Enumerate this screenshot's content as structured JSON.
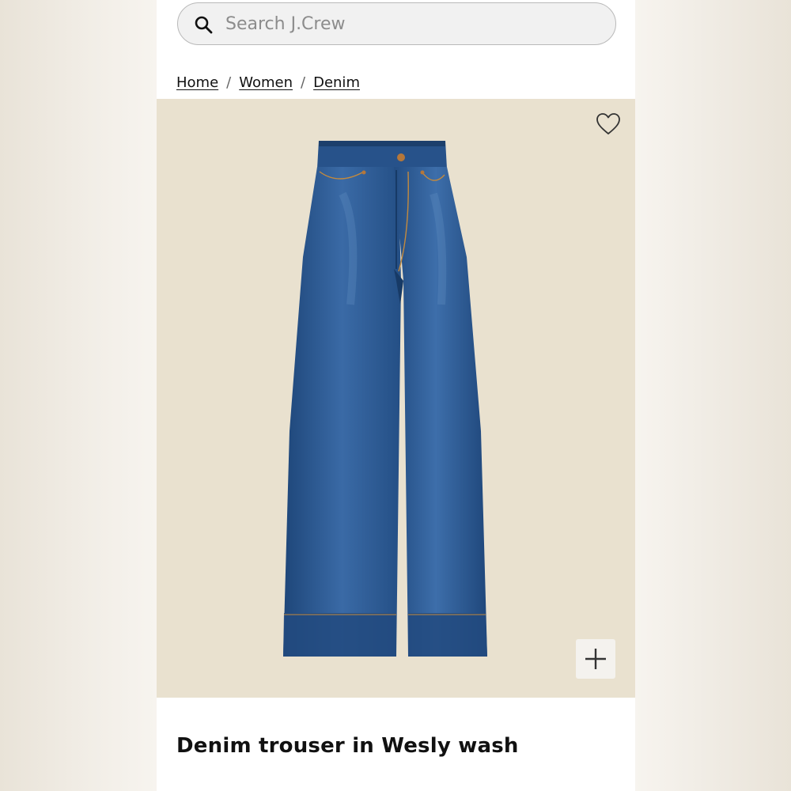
{
  "search": {
    "placeholder": "Search J.Crew",
    "icon": "search-icon"
  },
  "breadcrumb": {
    "items": [
      "Home",
      "Women",
      "Denim"
    ],
    "separator": "/"
  },
  "product": {
    "title": "Denim trouser in Wesly wash",
    "image_background": "#e9e1cf",
    "denim_color": "#2b5a93"
  },
  "icons": {
    "wishlist": "heart-icon",
    "zoom": "plus-icon"
  }
}
